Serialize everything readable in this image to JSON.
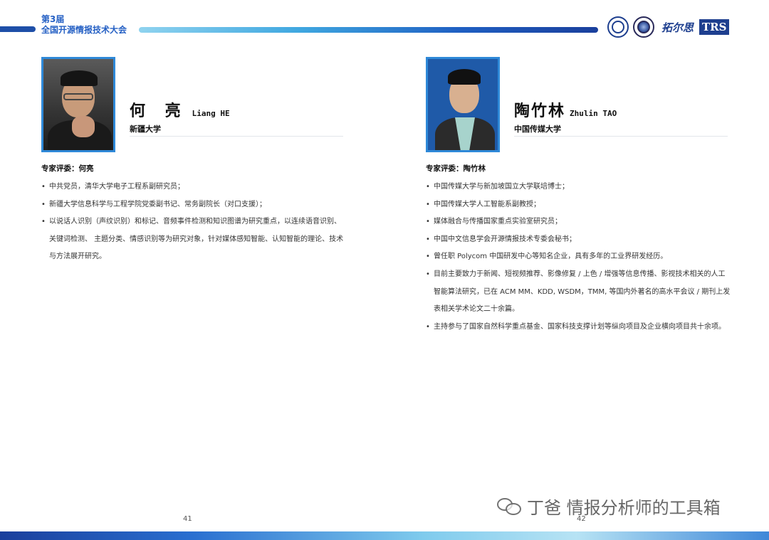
{
  "header": {
    "edition": "第3届",
    "conference": "全国开源情报技术大会",
    "logos": [
      {
        "icon": "university-seal-icon"
      },
      {
        "icon": "school-emblem-icon"
      },
      {
        "icon": "trs-logo-icon",
        "text": "拓尔思",
        "badge": "TRS"
      }
    ]
  },
  "profiles": [
    {
      "name_cn": "何 亮",
      "name_en": "Liang HE",
      "affiliation": "新疆大学",
      "expert_label": "专家评委：何亮",
      "bullets": [
        "中共党员，清华大学电子工程系副研究员；",
        "新疆大学信息科学与工程学院党委副书记、常务副院长（对口支援）；",
        "以说话人识别（声纹识别）和标记、音频事件检测和知识图谱为研究重点，以连续语音识别、关键词检测、 主题分类、情感识别等为研究对象，针对媒体感知智能、认知智能的理论、技术与方法展开研究。"
      ],
      "page_number": "41"
    },
    {
      "name_cn": "陶竹林",
      "name_en": "Zhulin TAO",
      "affiliation": "中国传媒大学",
      "expert_label": "专家评委：陶竹林",
      "bullets": [
        "中国传媒大学与新加坡国立大学联培博士；",
        "中国传媒大学人工智能系副教授；",
        "媒体融合与传播国家重点实验室研究员；",
        "中国中文信息学会开源情报技术专委会秘书；",
        "曾任职 Polycom 中国研发中心等知名企业，具有多年的工业界研发经历。",
        "目前主要致力于新闻、短视频推荐、影像修复 / 上色 / 增强等信息传播、影视技术相关的人工智能算法研究，已在 ACM MM、KDD, WSDM，TMM, 等国内外著名的高水平会议 / 期刊上发表相关学术论文二十余篇。",
        "主持参与了国家自然科学重点基金、国家科技支撑计划等纵向项目及企业横向项目共十余项。"
      ],
      "page_number": "42"
    }
  ],
  "bullet_symbol": "•",
  "watermark": {
    "text": "丁爸 情报分析师的工具箱",
    "icon": "wechat-icon"
  },
  "colors": {
    "accent": "#2560c4",
    "photo_border": "#2f89d8",
    "header_gradient_end": "#1a3f9c"
  }
}
